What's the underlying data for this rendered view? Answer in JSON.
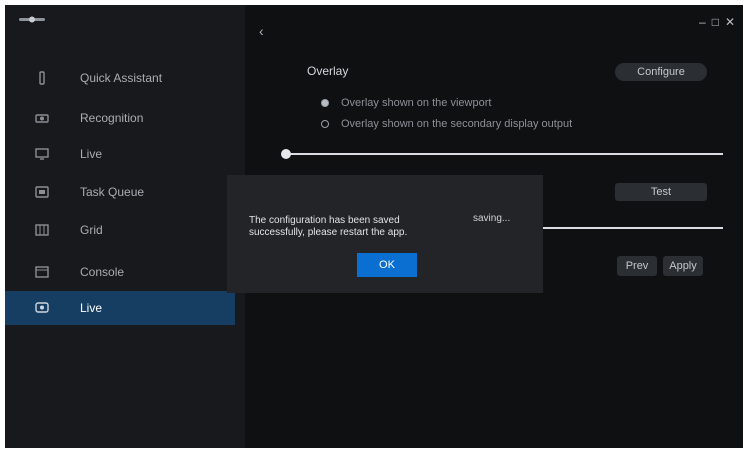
{
  "sidebar": {
    "items": [
      {
        "label": "Quick Assistant",
        "icon": "assistant-icon"
      },
      {
        "label": "Recognition",
        "icon": "face-icon"
      },
      {
        "label": "Live",
        "icon": "monitor-icon"
      },
      {
        "label": "Task Queue",
        "icon": "queue-icon"
      },
      {
        "label": "Grid",
        "icon": "grid-icon"
      },
      {
        "label": "Console",
        "icon": "console-icon"
      },
      {
        "label": "Live",
        "icon": "screen-icon"
      }
    ]
  },
  "main": {
    "section_title": "Overlay",
    "change_label": "Configure",
    "radio_1": "Overlay shown on the viewport",
    "radio_2": "Overlay shown on the secondary display output",
    "test_label": "Test",
    "prev_label": "Prev",
    "next_label": "Apply"
  },
  "dialog": {
    "message": "The configuration has been saved successfully, please restart the app.",
    "side_text": "saving...",
    "ok_label": "OK"
  },
  "colors": {
    "accent": "#0a6fd0",
    "active_nav": "#163e63",
    "background": "#101113"
  }
}
